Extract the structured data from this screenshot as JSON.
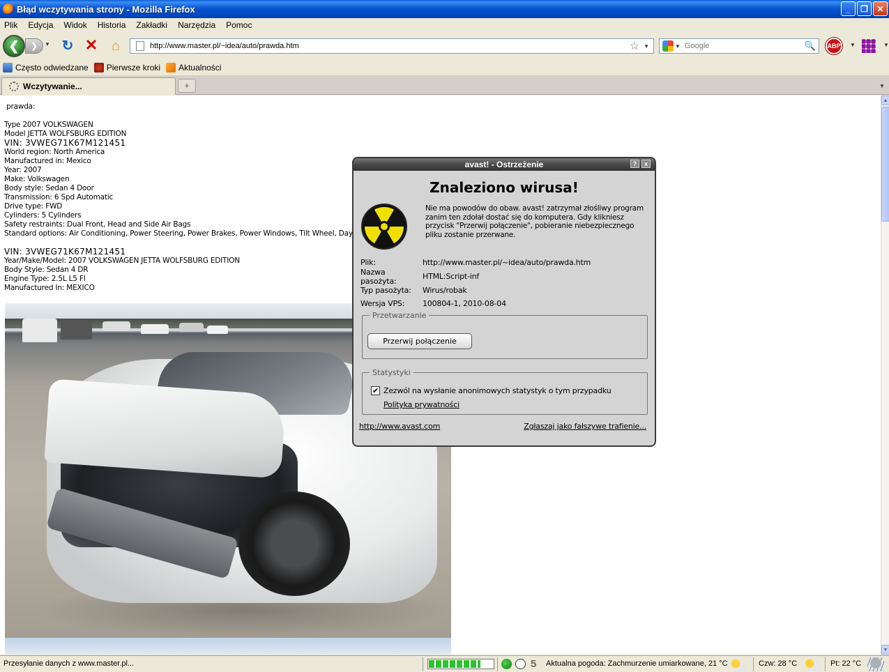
{
  "window": {
    "title": "Błąd wczytywania strony - Mozilla Firefox",
    "minimize": "_",
    "restore": "❐",
    "close": "✕"
  },
  "menu": [
    "Plik",
    "Edycja",
    "Widok",
    "Historia",
    "Zakładki",
    "Narzędzia",
    "Pomoc"
  ],
  "nav": {
    "url": "http://www.master.pl/~idea/auto/prawda.htm",
    "search_placeholder": "Google",
    "abp_label": "ABP"
  },
  "bookmarks": [
    "Często odwiedzane",
    "Pierwsze kroki",
    "Aktualności"
  ],
  "tab": {
    "label": "Wczytywanie...",
    "new_tab": "+"
  },
  "page": {
    "heading": "prawda:",
    "block1": [
      "Type 2007 VOLKSWAGEN",
      "Model JETTA WOLFSBURG EDITION",
      "VIN: 3VWEG71K67M121451",
      "World region: North America",
      "Manufactured in: Mexico",
      "Year: 2007",
      "Make: Volkswagen",
      "Body style: Sedan 4 Door",
      "Transmission: 6 Spd Automatic",
      "Drive type: FWD",
      "Cylinders: 5 Cylinders",
      "Safety restraints: Dual Front, Head and Side Air Bags",
      "Standard options: Air Conditioning, Power Steering, Power Brakes, Power Windows, Tilt Wheel, Daytime"
    ],
    "block2": [
      "VIN: 3VWEG71K67M121451",
      "Year/Make/Model: 2007 VOLKSWAGEN JETTA WOLFSBURG EDITION",
      "Body Style: Sedan 4 DR",
      "Engine Type: 2.5L L5 FI",
      "Manufactured In: MEXICO"
    ]
  },
  "avast": {
    "title": "avast! - Ostrzeżenie",
    "help_btn": "?",
    "close_btn": "x",
    "headline": "Znaleziono wirusa!",
    "message": "Nie ma powodów do obaw. avast! zatrzymał złośliwy program zanim ten zdołał dostać się do komputera. Gdy klikniesz przycisk \"Przerwij połączenie\", pobieranie niebezpiecznego pliku zostanie przerwane.",
    "info": [
      {
        "label": "Plik:",
        "value": "http://www.master.pl/~idea/auto/prawda.htm"
      },
      {
        "label": "Nazwa pasożyta:",
        "value": "HTML:Script-inf"
      },
      {
        "label": "Typ pasożyta:",
        "value": "Wirus/robak"
      },
      {
        "label": "Wersja VPS:",
        "value": "100804-1, 2010-08-04"
      }
    ],
    "processing_legend": "Przetwarzanie",
    "abort_button": "Przerwij połączenie",
    "stats_legend": "Statystyki",
    "stats_checkbox": "Zezwól na wysłanie anonimowych statystyk o tym przypadku",
    "stats_checked": true,
    "privacy_link": "Polityka prywatności",
    "home_link": "http://www.avast.com",
    "false_positive_link": "Zgłaszaj jako fałszywe trafienie..."
  },
  "status": {
    "text": "Przesyłanie danych z www.master.pl...",
    "progress_fraction": 0.8,
    "counter": "5",
    "weather_now": "Aktualna pogoda: Zachmurzenie umiarkowane, 21 °C",
    "weather_thu": "Czw: 28 °C",
    "weather_fri": "Pt: 22 °C"
  },
  "icons": {
    "app": "firefox-icon",
    "back": "back-arrow-icon",
    "forward": "forward-arrow-icon",
    "reload": "reload-icon",
    "stop": "stop-icon",
    "home": "home-icon",
    "hazard": "radiation-hazard-icon"
  }
}
